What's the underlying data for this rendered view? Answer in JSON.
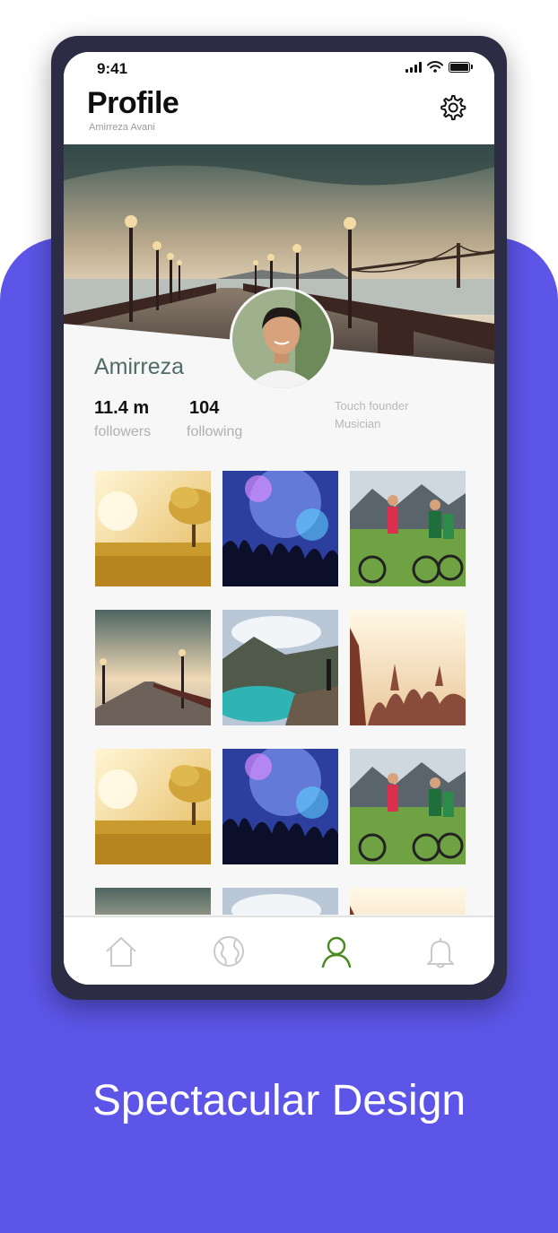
{
  "status_bar": {
    "time": "9:41"
  },
  "header": {
    "title": "Profile",
    "subtitle": "Amirreza Avani"
  },
  "profile": {
    "name": "Amirreza",
    "followers_count": "11.4 m",
    "followers_label": "followers",
    "following_count": "104",
    "following_label": "following",
    "bio_line1": "Touch founder",
    "bio_line2": "Musician"
  },
  "icons": {
    "settings": "gear-icon",
    "nav_home": "home-icon",
    "nav_explore": "globe-icon",
    "nav_profile": "user-icon",
    "nav_notifications": "bell-icon"
  },
  "colors": {
    "brand_background": "#5d55e8",
    "device_frame": "#2c2c44",
    "active_nav": "#4e8a22",
    "inactive_nav": "#c9c9c9",
    "name_text": "#4f6b66"
  },
  "photos": [
    "field",
    "concert",
    "cyclists",
    "pier",
    "lake",
    "crowd",
    "field",
    "concert",
    "cyclists",
    "pier",
    "lake",
    "crowd"
  ],
  "nav": {
    "active": "profile"
  },
  "marketing": {
    "caption": "Spectacular Design"
  }
}
